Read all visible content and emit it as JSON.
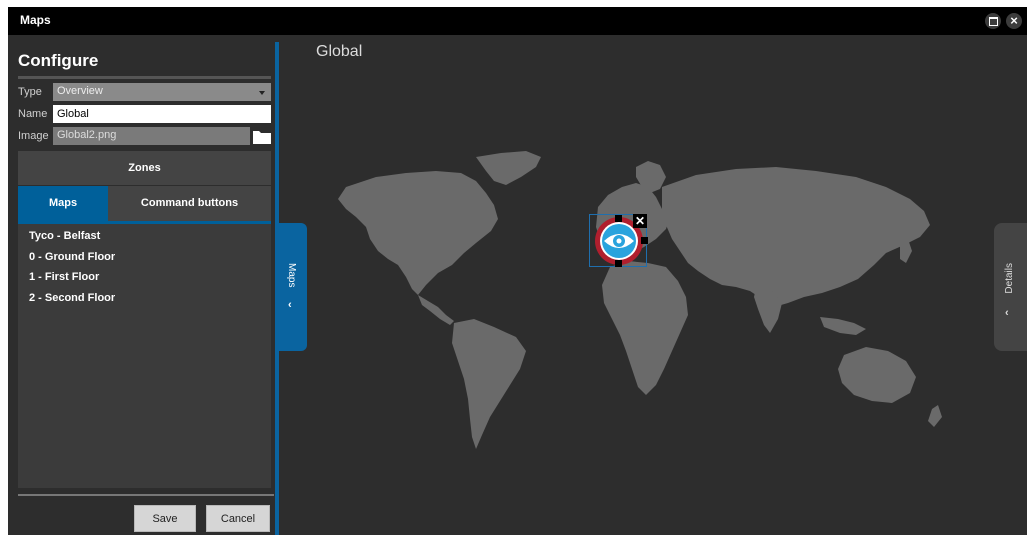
{
  "window": {
    "title": "Maps"
  },
  "config": {
    "heading": "Configure",
    "type_label": "Type",
    "type_value": "Overview",
    "name_label": "Name",
    "name_value": "Global",
    "image_label": "Image",
    "image_value": "Global2.png"
  },
  "tabs": {
    "zones": "Zones",
    "maps": "Maps",
    "command_buttons": "Command buttons"
  },
  "map_list": [
    "Tyco - Belfast",
    "0 - Ground Floor",
    "1 - First Floor",
    "2 - Second Floor"
  ],
  "buttons": {
    "save": "Save",
    "cancel": "Cancel"
  },
  "side_handles": {
    "maps": "Maps",
    "details": "Details"
  },
  "main": {
    "title": "Global"
  },
  "marker": {
    "icon": "eye-icon",
    "close_glyph": "✕"
  },
  "colors": {
    "accent": "#0a64a0",
    "marker_ring": "#b01f2e",
    "marker_eye": "#29a3dd",
    "land": "#6a6a6a",
    "background": "#2d2d2d"
  }
}
